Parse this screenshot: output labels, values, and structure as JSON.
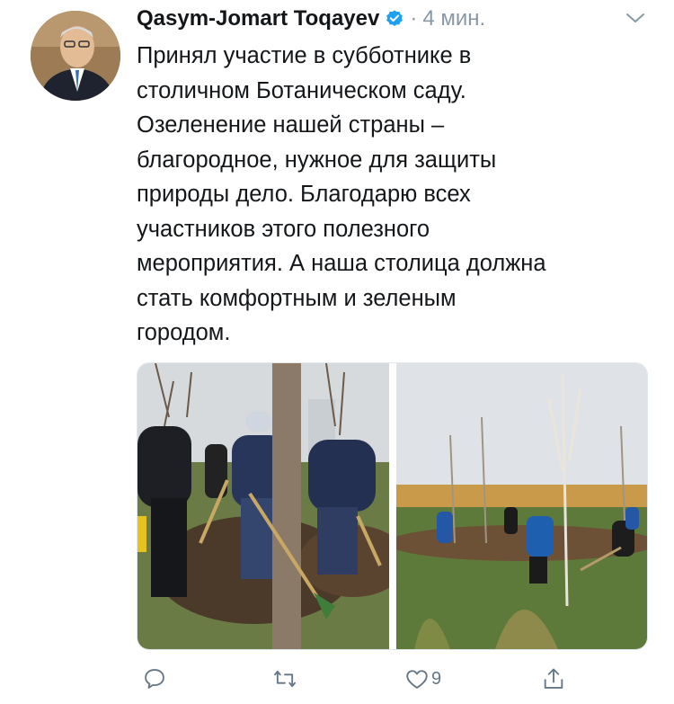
{
  "tweet": {
    "author_name": "Qasym-Jomart Toqayev",
    "separator": "·",
    "time": "4 мин.",
    "text": "Принял участие в субботнике в\nстоличном Ботаническом саду.\nОзеленение нашей страны –\nблагородное, нужное для защиты\nприроды дело. Благодарю всех\nучастников этого полезного\nмероприятия. А наша столица должна\nстать комфортным и зеленым\nгородом.",
    "verified_icon": "verified-badge-icon",
    "more_icon": "chevron-down-icon"
  },
  "actions": {
    "reply_icon": "reply-icon",
    "retweet_icon": "retweet-icon",
    "like_icon": "heart-icon",
    "like_count": "9",
    "share_icon": "share-icon"
  },
  "colors": {
    "text": "#14171a",
    "secondary": "#8899a6",
    "accent": "#1da1f2"
  }
}
